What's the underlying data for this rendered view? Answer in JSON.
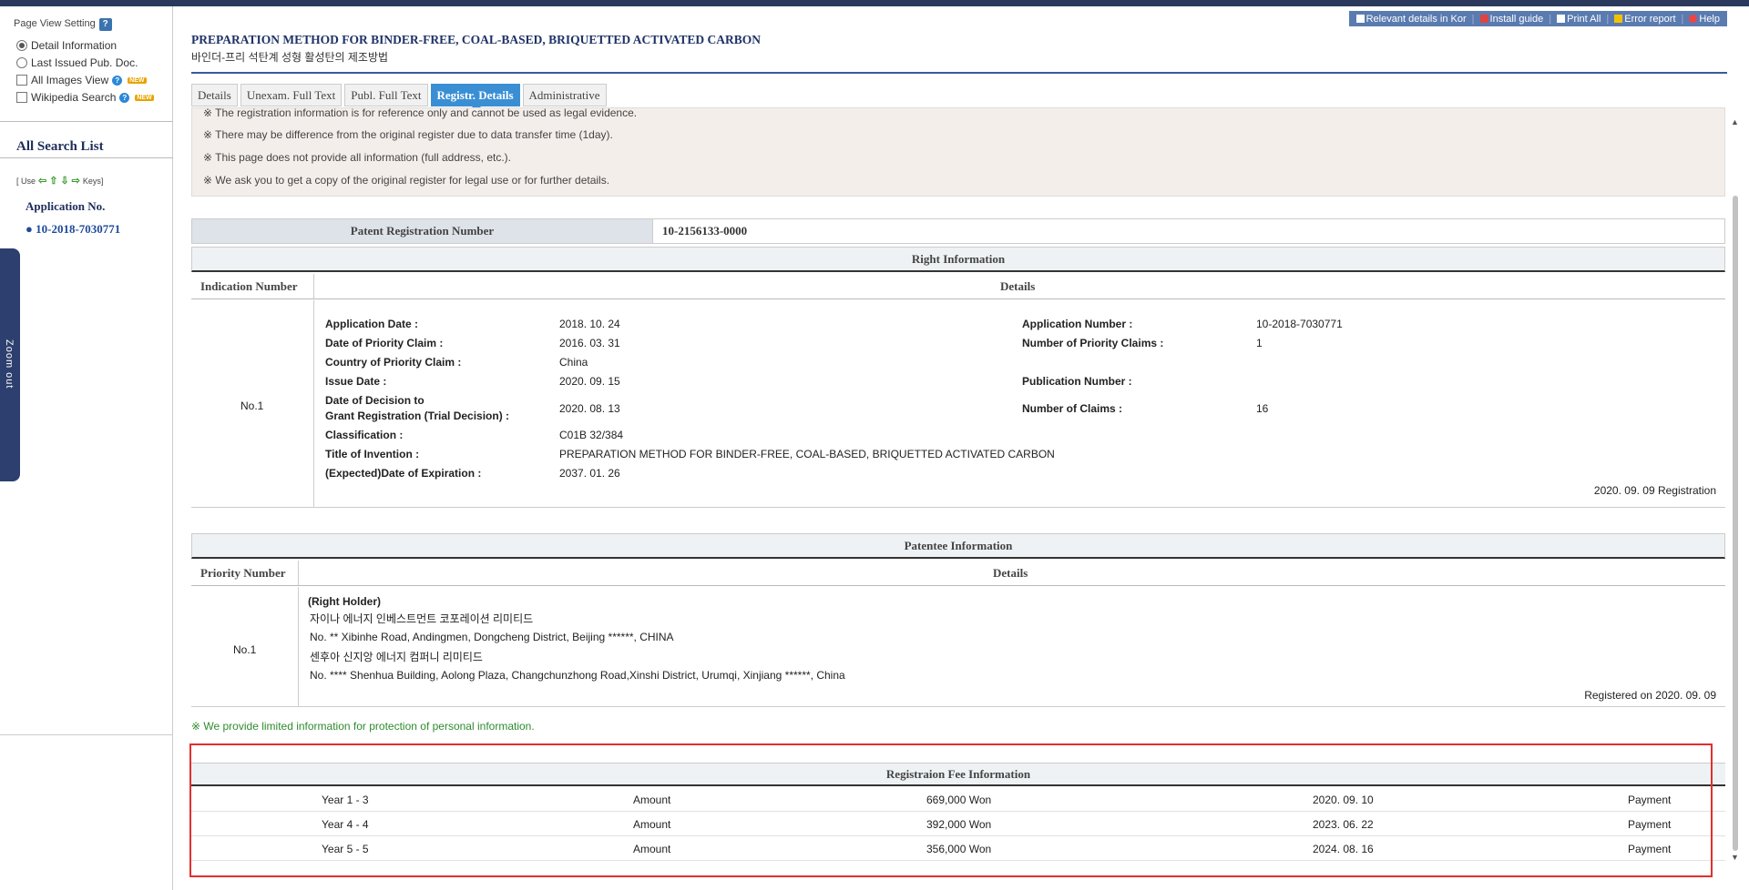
{
  "sidebar": {
    "page_view_setting": "Page View Setting",
    "help_label": "?",
    "options": [
      {
        "label": "Detail Information",
        "type": "radio",
        "checked": true
      },
      {
        "label": "Last Issued Pub. Doc.",
        "type": "radio",
        "checked": false
      },
      {
        "label": "All Images View",
        "type": "checkbox",
        "checked": false,
        "badge": "NEW"
      },
      {
        "label": "Wikipedia Search",
        "type": "checkbox",
        "checked": false,
        "badge": "NEW"
      }
    ],
    "all_search_list": "All Search List",
    "keys_hint_prefix": "[ Use",
    "keys_hint_suffix": "Keys]",
    "app_no_label": "Application No.",
    "app_no_value": "10-2018-7030771",
    "zoom_label": "Zoom out"
  },
  "toolbar": {
    "items": [
      "Relevant details in Kor",
      "Install guide",
      "Print All",
      "Error report",
      "Help"
    ]
  },
  "title": {
    "en": "PREPARATION METHOD FOR BINDER-FREE, COAL-BASED, BRIQUETTED ACTIVATED CARBON",
    "ko": "바인더-프리 석탄계 성형 활성탄의 제조방법"
  },
  "tabs": [
    {
      "label": "Details",
      "active": false
    },
    {
      "label": "Unexam. Full Text",
      "active": false
    },
    {
      "label": "Publ. Full Text",
      "active": false
    },
    {
      "label": "Registr. Details",
      "active": true
    },
    {
      "label": "Administrative",
      "active": false
    }
  ],
  "notices": [
    "※ The registration information is for reference only and cannot be used as legal evidence.",
    "※ There may be difference from the original register due to data transfer time (1day).",
    "※ This page does not provide all information (full address, etc.).",
    "※ We ask you to get a copy of the original register for legal use or for further details."
  ],
  "registration": {
    "label": "Patent Registration Number",
    "value": "10-2156133-0000"
  },
  "right_info": {
    "header": "Right Information",
    "col_indication": "Indication Number",
    "col_details": "Details",
    "indication": "No.1",
    "left_fields": [
      {
        "k": "Application Date :",
        "v": "2018. 10. 24"
      },
      {
        "k": "Date of Priority Claim :",
        "v": "2016. 03. 31"
      },
      {
        "k": "Country of Priority Claim :",
        "v": "China"
      },
      {
        "k": "Issue Date :",
        "v": "2020. 09. 15"
      },
      {
        "k": "Date of Decision to",
        "k2": "Grant Registration (Trial Decision) :",
        "v": "2020. 08. 13"
      },
      {
        "k": "Classification :",
        "v": "C01B 32/384"
      },
      {
        "k": "Title of Invention :",
        "v": "PREPARATION METHOD FOR BINDER-FREE, COAL-BASED, BRIQUETTED ACTIVATED CARBON"
      },
      {
        "k": "(Expected)Date of Expiration :",
        "v": "2037. 01. 26"
      }
    ],
    "right_fields": [
      {
        "k": "Application Number :",
        "v": "10-2018-7030771"
      },
      {
        "k": "Number of Priority Claims :",
        "v": "1"
      },
      {
        "k": "Publication Number :",
        "v": ""
      },
      {
        "k": "Number of Claims :",
        "v": "16"
      }
    ],
    "footer": "2020. 09. 09 Registration"
  },
  "patentee": {
    "header": "Patentee Information",
    "col_priority": "Priority Number",
    "col_details": "Details",
    "priority": "No.1",
    "role": "(Right Holder)",
    "lines": [
      "자이나 에너지 인베스트먼트 코포레이션 리미티드",
      "No. ** Xibinhe Road, Andingmen, Dongcheng District, Beijing ******, CHINA",
      "센후아 신지앙 에너지 컴퍼니 리미티드",
      "No. **** Shenhua Building, Aolong Plaza, Changchunzhong Road,Xinshi District, Urumqi, Xinjiang ******, China"
    ],
    "footer": "Registered on 2020. 09. 09"
  },
  "privacy_note": "※ We provide limited information for protection of personal information.",
  "fees": {
    "header": "Registraion Fee Information",
    "rows": [
      {
        "year": "Year 1 - 3",
        "label": "Amount",
        "amount": "669,000 Won",
        "date": "2020. 09. 10",
        "status": "Payment"
      },
      {
        "year": "Year 4 - 4",
        "label": "Amount",
        "amount": "392,000 Won",
        "date": "2023. 06. 22",
        "status": "Payment"
      },
      {
        "year": "Year 5 - 5",
        "label": "Amount",
        "amount": "356,000 Won",
        "date": "2024. 08. 16",
        "status": "Payment"
      }
    ]
  }
}
